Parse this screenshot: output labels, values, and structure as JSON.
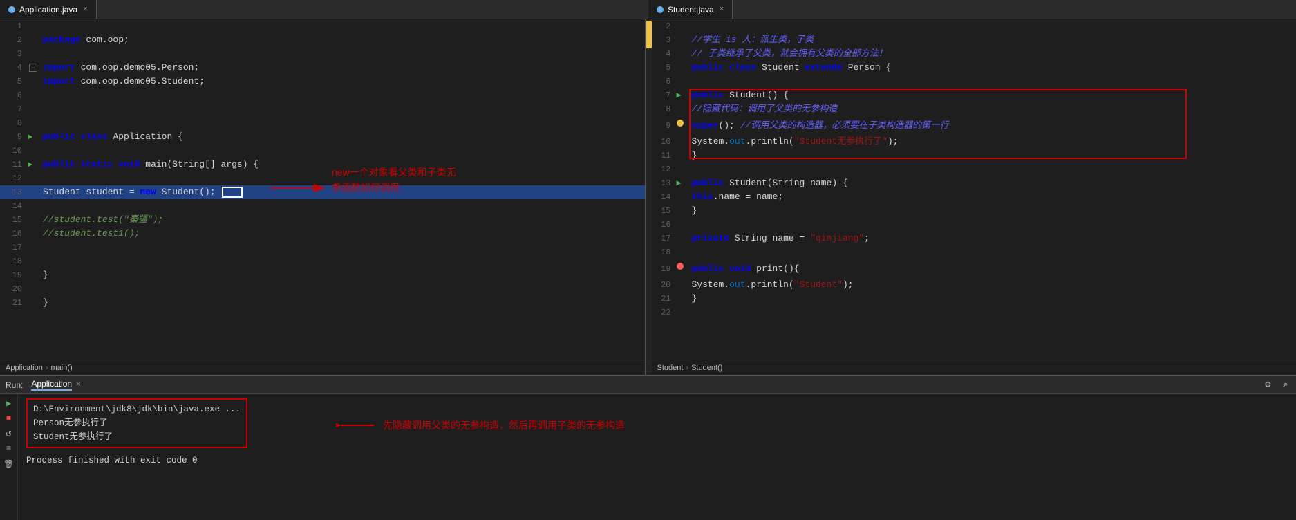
{
  "tabs": {
    "left": {
      "label": "Application.java",
      "active": true,
      "icon_color": "#6baeef"
    },
    "right": {
      "label": "Student.java",
      "active": true,
      "icon_color": "#6baeef"
    }
  },
  "left_editor": {
    "breadcrumb": {
      "class": "Application",
      "method": "main()"
    },
    "lines": [
      {
        "num": 1,
        "content": "",
        "highlight": false
      },
      {
        "num": 2,
        "content": "package com.oop;",
        "highlight": false
      },
      {
        "num": 3,
        "content": "",
        "highlight": false
      },
      {
        "num": 4,
        "content": "",
        "highlight": false
      },
      {
        "num": 5,
        "content": "import com.oop.demo05.Person;",
        "highlight": false
      },
      {
        "num": 6,
        "content": "import com.oop.demo05.Student;",
        "highlight": false
      },
      {
        "num": 7,
        "content": "",
        "highlight": false
      },
      {
        "num": 8,
        "content": "",
        "highlight": false
      },
      {
        "num": 9,
        "content": "public class Application {",
        "highlight": false
      },
      {
        "num": 10,
        "content": "",
        "highlight": false
      },
      {
        "num": 11,
        "content": "    public static void main(String[] args) {",
        "highlight": false
      },
      {
        "num": 12,
        "content": "",
        "highlight": false
      },
      {
        "num": 13,
        "content": "        Student student = new Student();",
        "highlight": true
      },
      {
        "num": 14,
        "content": "",
        "highlight": false
      },
      {
        "num": 15,
        "content": "        //student.test(\"秦疆\");",
        "highlight": false
      },
      {
        "num": 16,
        "content": "        //student.test1();",
        "highlight": false
      },
      {
        "num": 17,
        "content": "",
        "highlight": false
      },
      {
        "num": 18,
        "content": "",
        "highlight": false
      },
      {
        "num": 19,
        "content": "    }",
        "highlight": false
      },
      {
        "num": 20,
        "content": "",
        "highlight": false
      },
      {
        "num": 21,
        "content": "}",
        "highlight": false
      }
    ],
    "annotation": {
      "text": "new一个对象看父类和子类无\n参函数如何调用",
      "arrow_from": "line13"
    }
  },
  "right_editor": {
    "breadcrumb": {
      "class": "Student",
      "method": "Student()"
    },
    "lines": [
      {
        "num": 2,
        "content": ""
      },
      {
        "num": 3,
        "content": "//学生 is 人：派生类，子类"
      },
      {
        "num": 4,
        "content": "// 子类继承了父类，就会拥有父类的全部方法！"
      },
      {
        "num": 5,
        "content": "public class Student extends Person {"
      },
      {
        "num": 6,
        "content": ""
      },
      {
        "num": 7,
        "content": "    public Student() {"
      },
      {
        "num": 8,
        "content": "        //隐藏代码：调用了父类的无参构造"
      },
      {
        "num": 9,
        "content": "        super(); //调用父类的构造器，必须要在子类构造器的第一行"
      },
      {
        "num": 10,
        "content": "        System.out.println(\"Student无参执行了\");"
      },
      {
        "num": 11,
        "content": "    }"
      },
      {
        "num": 12,
        "content": ""
      },
      {
        "num": 13,
        "content": "    public Student(String name) {"
      },
      {
        "num": 14,
        "content": "        this.name = name;"
      },
      {
        "num": 15,
        "content": "    }"
      },
      {
        "num": 16,
        "content": ""
      },
      {
        "num": 17,
        "content": "    private String name = \"qinjiang\";"
      },
      {
        "num": 18,
        "content": ""
      },
      {
        "num": 19,
        "content": "    public void print(){"
      },
      {
        "num": 20,
        "content": "        System.out.println(\"Student\");"
      },
      {
        "num": 21,
        "content": "    }"
      },
      {
        "num": 22,
        "content": ""
      }
    ]
  },
  "bottom_panel": {
    "run_label": "Run:",
    "tab_label": "Application",
    "output_lines": [
      "D:\\Environment\\jdk8\\jdk\\bin\\java.exe ...",
      "Person无参执行了",
      "Student无参执行了",
      "",
      "Process finished with exit code 0"
    ],
    "annotation": {
      "text": "先隐藏调用父类的无参构造，然后再调用子类的无参构造"
    }
  },
  "icons": {
    "play": "▶",
    "stop": "■",
    "rerun": "↺",
    "close": "×",
    "settings": "⚙",
    "chevron_right": "›"
  }
}
